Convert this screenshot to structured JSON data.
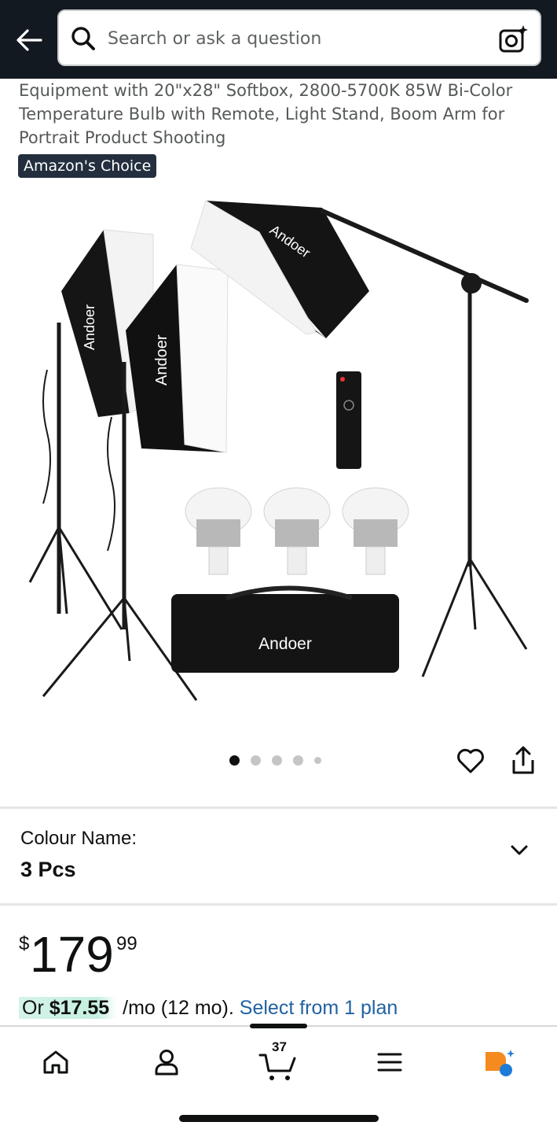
{
  "header": {
    "search_placeholder": "Search or ask a question"
  },
  "product": {
    "title": "Equipment with 20\"x28\" Softbox, 2800-5700K 85W Bi-Color Temperature Bulb with Remote, Light Stand, Boom Arm for Portrait Product Shooting",
    "badge": "Amazon's Choice",
    "brand_on_image": "Andoer",
    "image_dots": {
      "count": 5,
      "active_index": 0
    }
  },
  "variant": {
    "label": "Colour Name:",
    "value": "3 Pcs"
  },
  "price": {
    "symbol": "$",
    "whole": "179",
    "fraction": "99"
  },
  "installment": {
    "prefix": "Or ",
    "amount": "$17.55",
    "suffix": " /mo (12 mo). ",
    "link": "Select from 1 plan"
  },
  "bottom_nav": {
    "cart_count": "37",
    "items": [
      "home-icon",
      "account-icon",
      "cart-icon",
      "menu-icon",
      "rufus-icon"
    ]
  },
  "colors": {
    "header_bg": "#131921",
    "badge_bg": "#232f3e",
    "link": "#2162a1",
    "installment_highlight": "#c5efdf",
    "rufus_orange": "#f58a1f",
    "rufus_blue": "#1f7bd8"
  }
}
